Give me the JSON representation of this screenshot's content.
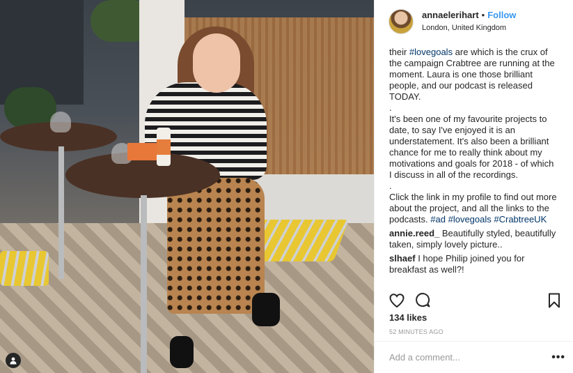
{
  "post": {
    "username": "annaelerihart",
    "separator": "•",
    "follow_label": "Follow",
    "location": "London, United Kingdom"
  },
  "caption": {
    "p1_a": "their ",
    "p1_tag": "#lovegoals",
    "p1_b": " are which is the crux of the campaign Crabtree are running at the moment. Laura is one those brilliant people, and our podcast is released TODAY.",
    "dot1": ".",
    "p2": "It's been one of my favourite projects to date, to say I've enjoyed it is an understatement. It's also been a brilliant chance for me to really think about my motivations and goals for 2018 - of which I discuss in all of the recordings.",
    "dot2": ".",
    "p3": "Click the link in my profile to find out more about the project, and all the links to the podcasts. ",
    "tags": [
      "#ad",
      "#lovegoals",
      "#CrabtreeUK"
    ]
  },
  "comments": [
    {
      "user": "annie.reed_",
      "text": "Beautifully styled, beautifully taken, simply lovely picture.."
    },
    {
      "user": "slhaef",
      "text": "I hope Philip joined you for breakfast as well?!"
    }
  ],
  "stats": {
    "likes": "134 likes",
    "time": "52 MINUTES AGO"
  },
  "comment_box": {
    "placeholder": "Add a comment...",
    "more_label": "•••"
  },
  "icons": {
    "like": "heart-icon",
    "comment": "comment-bubble-icon",
    "save": "bookmark-icon",
    "tagged": "person-tag-icon"
  }
}
